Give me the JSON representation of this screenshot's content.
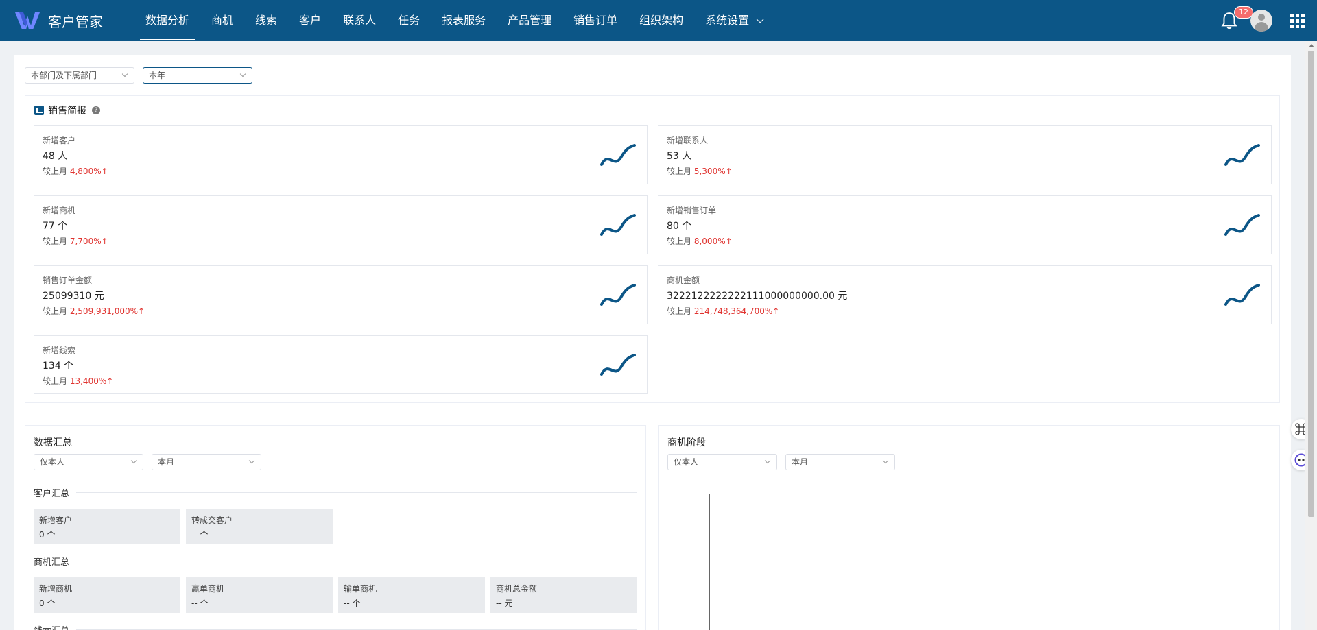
{
  "brand": {
    "name": "客户管家",
    "accent": "#0c5687"
  },
  "nav": [
    {
      "label": "数据分析",
      "active": true
    },
    {
      "label": "商机"
    },
    {
      "label": "线索"
    },
    {
      "label": "客户"
    },
    {
      "label": "联系人"
    },
    {
      "label": "任务"
    },
    {
      "label": "报表服务"
    },
    {
      "label": "产品管理"
    },
    {
      "label": "销售订单"
    },
    {
      "label": "组织架构"
    },
    {
      "label": "系统设置"
    }
  ],
  "header": {
    "notification_count": "12"
  },
  "filters": {
    "dept": "本部门及下属部门",
    "period": "本年"
  },
  "report": {
    "title": "销售简报",
    "compare_label": "较上月",
    "cards": [
      {
        "title": "新增客户",
        "value": "48 人",
        "pct": "4,800%↑"
      },
      {
        "title": "新增联系人",
        "value": "53 人",
        "pct": "5,300%↑"
      },
      {
        "title": "新增商机",
        "value": "77 个",
        "pct": "7,700%↑"
      },
      {
        "title": "新增销售订单",
        "value": "80 个",
        "pct": "8,000%↑"
      },
      {
        "title": "销售订单金额",
        "value": "25099310 元",
        "pct": "2,509,931,000%↑"
      },
      {
        "title": "商机金额",
        "value": "3222122222222111000000000.00 元",
        "pct": "214,748,364,700%↑"
      },
      {
        "title": "新增线索",
        "value": "134 个",
        "pct": "13,400%↑"
      }
    ]
  },
  "summary": {
    "title": "数据汇总",
    "scope": "仅本人",
    "period": "本月",
    "customer_section": "客户汇总",
    "customer_stats": [
      {
        "label": "新增客户",
        "value": "0 个"
      },
      {
        "label": "转成交客户",
        "value": "-- 个"
      }
    ],
    "opportunity_section": "商机汇总",
    "opportunity_stats": [
      {
        "label": "新增商机",
        "value": "0 个"
      },
      {
        "label": "赢单商机",
        "value": "-- 个"
      },
      {
        "label": "输单商机",
        "value": "-- 个"
      },
      {
        "label": "商机总金额",
        "value": "-- 元"
      }
    ],
    "lead_section": "线索汇总"
  },
  "stage": {
    "title": "商机阶段",
    "scope": "仅本人",
    "period": "本月"
  }
}
